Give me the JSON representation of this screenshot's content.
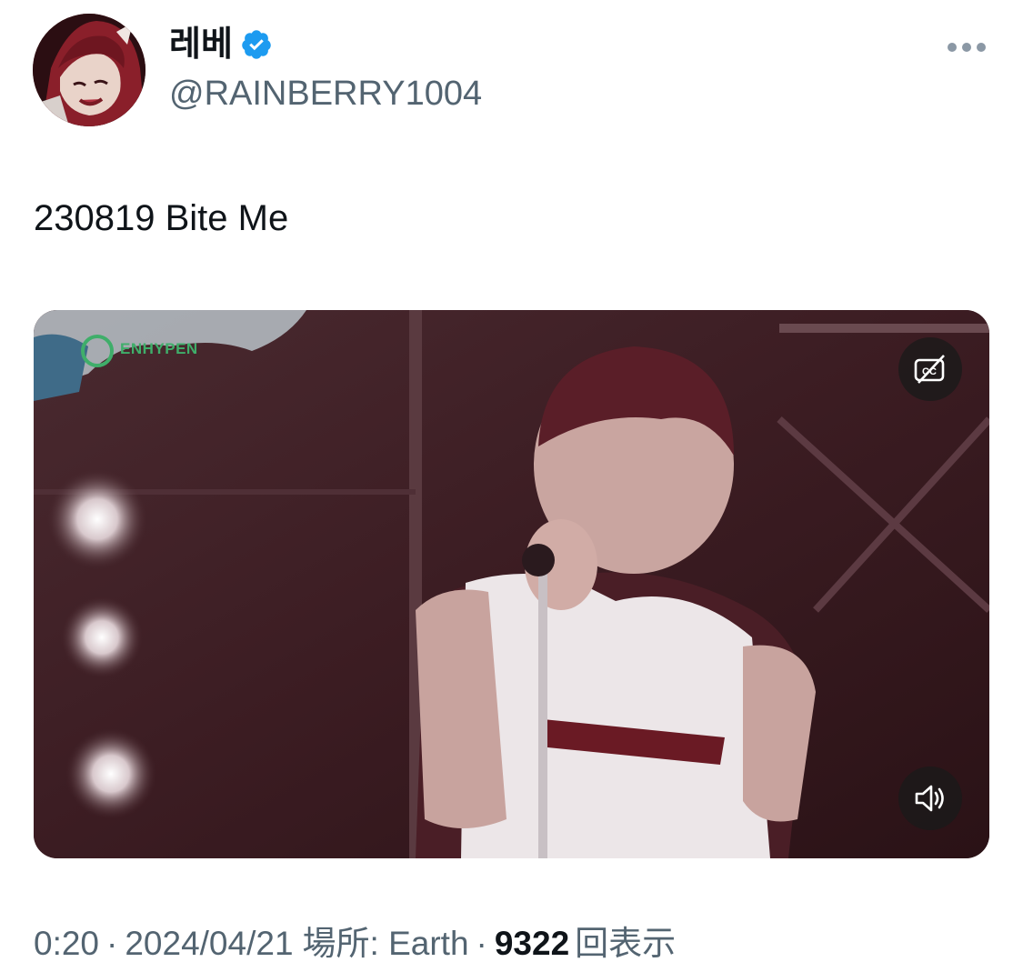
{
  "author": {
    "display_name": "레베",
    "handle": "@RAINBERRY1004",
    "verified": true,
    "avatar_icon": "anime-character-avatar"
  },
  "tweet": {
    "text": "230819 Bite Me"
  },
  "media": {
    "type": "video",
    "overlay_logo_text": "ENHYPEN",
    "cc_icon": "captions-off-icon",
    "volume_icon": "volume-muted-icon"
  },
  "meta": {
    "duration": "0:20",
    "separator": "·",
    "date": "2024/04/21",
    "location": "場所: Earth",
    "views_count": "9322",
    "views_label": "回表示"
  },
  "colors": {
    "text_primary": "#0f1419",
    "text_secondary": "#536471",
    "verified_blue": "#1d9bf0"
  }
}
